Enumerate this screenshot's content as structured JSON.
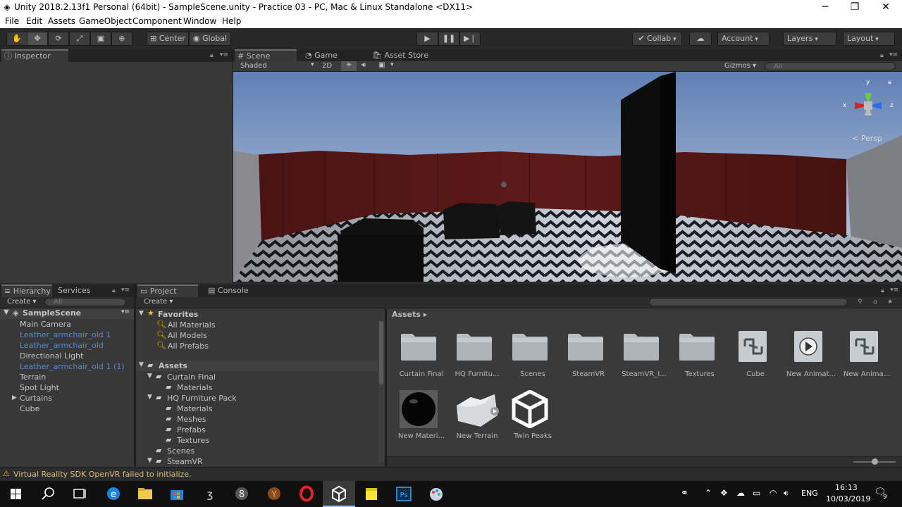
{
  "window": {
    "title": "Unity 2018.2.13f1 Personal (64bit) - SampleScene.unity - Practice 03 - PC, Mac & Linux Standalone <DX11>",
    "controls": [
      "─",
      "❐",
      "✕"
    ]
  },
  "menu": [
    "File",
    "Edit",
    "Assets",
    "GameObject",
    "Component",
    "Window",
    "Help"
  ],
  "toolbar": {
    "pivot": "Center",
    "space": "Global",
    "collab": "Collab",
    "account": "Account",
    "layers": "Layers",
    "layout": "Layout"
  },
  "inspector": {
    "tab": "Inspector"
  },
  "scene": {
    "tabs": [
      "Scene",
      "Game",
      "Asset Store"
    ],
    "shading": "Shaded",
    "mode2d": "2D",
    "gizmos": "Gizmos",
    "search_placeholder": "All",
    "persp": "< Persp",
    "axes": {
      "x": "x",
      "y": "y",
      "z": "z"
    }
  },
  "hierarchy": {
    "tabs": [
      "Hierarchy",
      "Services"
    ],
    "create": "Create",
    "search_placeholder": "All",
    "scene_name": "SampleScene",
    "items": [
      {
        "label": "Main Camera",
        "prefab": false
      },
      {
        "label": "Leather_armchair_old 1",
        "prefab": true
      },
      {
        "label": "Leather_armchair_old",
        "prefab": true
      },
      {
        "label": "Directional Light",
        "prefab": false
      },
      {
        "label": "Leather_armchair_old 1 (1)",
        "prefab": true
      },
      {
        "label": "Terrain",
        "prefab": false
      },
      {
        "label": "Spot Light",
        "prefab": false
      },
      {
        "label": "Curtains",
        "prefab": false
      },
      {
        "label": "Cube",
        "prefab": false
      }
    ]
  },
  "project": {
    "tabs": [
      "Project",
      "Console"
    ],
    "create": "Create",
    "favorites_label": "Favorites",
    "favorites": [
      "All Materials",
      "All Models",
      "All Prefabs"
    ],
    "assets_label": "Assets",
    "tree": [
      "Curtain Final",
      "Materials",
      "HQ Furniture Pack",
      "Materials",
      "Meshes",
      "Prefabs",
      "Textures",
      "Scenes",
      "SteamVR"
    ],
    "breadcrumb": "Assets ▸",
    "grid": [
      "Curtain Final",
      "HQ Furnitu...",
      "Scenes",
      "SteamVR",
      "SteamVR_I...",
      "Textures",
      "Cube",
      "New Animat...",
      "New Anima...",
      "New Materi...",
      "New Terrain",
      "Twin Peaks"
    ]
  },
  "status": {
    "message": "Virtual Reality SDK OpenVR failed to initialize."
  },
  "taskbar": {
    "lang": "ENG",
    "time": "16:13",
    "date": "10/03/2019",
    "notifications": "9"
  },
  "colors": {
    "unity_blue": "#4f8bd9",
    "panel": "#383838",
    "warning": "#e8b400"
  }
}
